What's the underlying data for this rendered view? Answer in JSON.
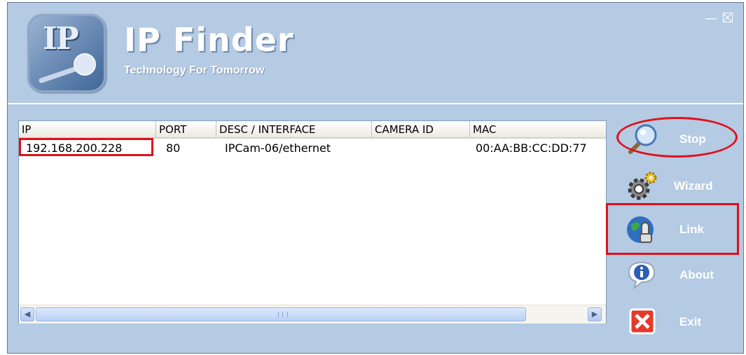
{
  "app": {
    "title": "IP Finder",
    "subtitle": "Technology For Tomorrow",
    "logo_text": "IP"
  },
  "window_controls": {
    "minimize": "—",
    "close": ""
  },
  "table": {
    "columns": [
      "IP",
      "PORT",
      "DESC / INTERFACE",
      "CAMERA ID",
      "MAC"
    ],
    "rows": [
      {
        "ip": "192.168.200.228",
        "port": "80",
        "desc": "IPCam-06/ethernet",
        "camera_id": "",
        "mac": "00:AA:BB:CC:DD:77"
      }
    ]
  },
  "actions": {
    "stop": "Stop",
    "wizard": "Wizard",
    "link": "Link",
    "about": "About",
    "exit": "Exit"
  },
  "colors": {
    "window_bg": "#b5cae3",
    "highlight": "#e0101a"
  }
}
